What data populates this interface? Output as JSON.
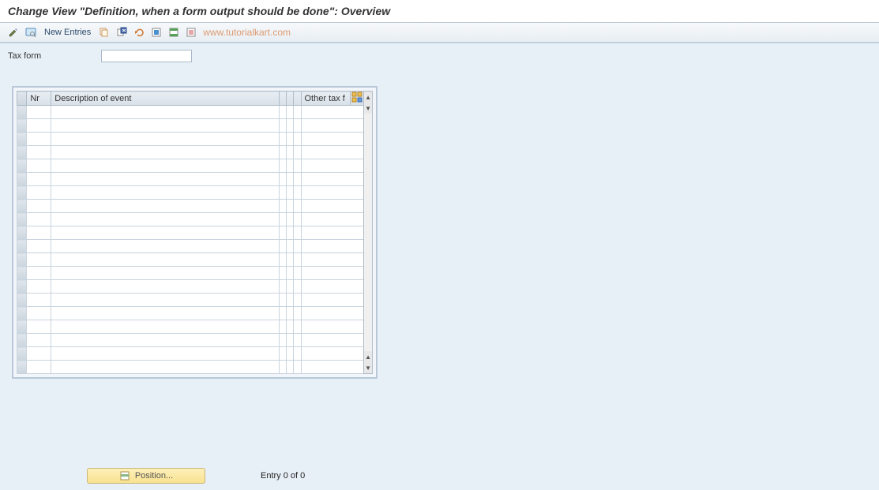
{
  "header": {
    "title": "Change View \"Definition, when a form output should be done\": Overview"
  },
  "toolbar": {
    "new_entries_label": "New Entries",
    "watermark": "www.tutorialkart.com"
  },
  "form": {
    "tax_form_label": "Tax form",
    "tax_form_value": ""
  },
  "table": {
    "columns": {
      "nr": "Nr",
      "description": "Description of event",
      "other_tax": "Other tax f"
    },
    "rows": 20
  },
  "footer": {
    "position_label": "Position...",
    "entry_text": "Entry 0 of 0"
  }
}
